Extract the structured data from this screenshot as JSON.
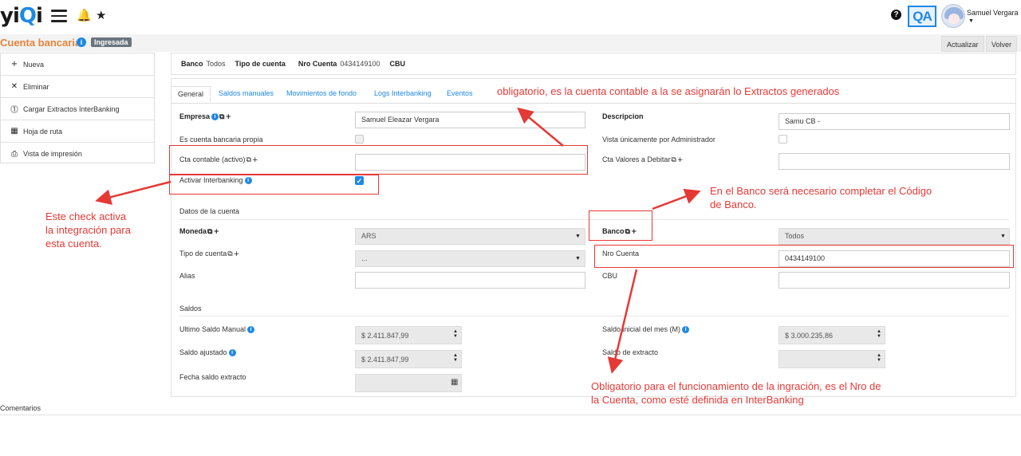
{
  "app": {
    "logo_prefix": "yi",
    "logo_q": "Q",
    "logo_suffix": "i",
    "bell_icon": "🔔",
    "star_icon": "★",
    "help_label": "?",
    "qa_label": "QA",
    "user_name": "Samuel Vergara"
  },
  "title": {
    "text": "Cuenta bancaria",
    "info": "i",
    "status": "Ingresada",
    "update_btn": "Actualizar",
    "back_btn": "Volver"
  },
  "sidebar": {
    "items": [
      {
        "icon": "+",
        "label": "Nueva"
      },
      {
        "icon": "✕",
        "label": "Eliminar"
      },
      {
        "icon": "⓵",
        "label": "Cargar Extractos InterBanking"
      },
      {
        "icon": "▦",
        "label": "Hoja de ruta"
      },
      {
        "icon": "⎙",
        "label": "Vista de impresión"
      }
    ]
  },
  "infostrip": {
    "banco_label": "Banco",
    "banco_value": "Todos",
    "tipo_label": "Tipo de cuenta",
    "nro_label": "Nro Cuenta",
    "nro_value": "0434149100",
    "cbu_label": "CBU"
  },
  "tabs": [
    "General",
    "Saldos manuales",
    "Movimientos de fondo",
    "Logs Interbanking",
    "Eventos"
  ],
  "form": {
    "empresa_label": "Empresa",
    "empresa_value": "Samuel Eleazar Vergara",
    "descripcion_label": "Descripcion",
    "descripcion_value": "Samu CB -",
    "propia_label": "Es cuenta bancaria propia",
    "admin_label": "Vista únicamente por Administrador",
    "cta_contable_label": "Cta contable (activo)",
    "cta_valores_label": "Cta Valores a Debitar",
    "interbanking_label": "Activar Interbanking",
    "datos_section": "Datos de la cuenta",
    "moneda_label": "Moneda",
    "moneda_value": "ARS",
    "banco_label": "Banco",
    "banco_value": "Todos",
    "tipo_label": "Tipo de cuenta",
    "tipo_value": "...",
    "nro_label": "Nro Cuenta",
    "nro_value": "0434149100",
    "alias_label": "Alias",
    "cbu_label": "CBU",
    "saldos_section": "Saldos",
    "ultimo_label": "Ultimo Saldo Manual",
    "ultimo_value": "$ 2.411.847,99",
    "inicial_label": "Saldo inicial del mes (M)",
    "inicial_value": "$ 3.000.235,86",
    "ajustado_label": "Saldo ajustado",
    "ajustado_value": "$ 2.411.847,99",
    "extracto_label": "Saldo de extracto",
    "fecha_label": "Fecha saldo extracto"
  },
  "annotations": {
    "top": "obligatorio, es la cuenta contable a la se asignarán lo Extractos generados",
    "left_1": "Este check activa",
    "left_2": "la integración para",
    "left_3": "esta cuenta.",
    "banco_1": "En el Banco será necesario completar el Código",
    "banco_2": "de Banco.",
    "nro_1": "Obligatorio para el funcionamiento de la ingración, es el Nro de",
    "nro_2": "la Cuenta, como esté definida en InterBanking"
  },
  "comments_label": "Comentarios",
  "colors": {
    "accent": "#1e88e5",
    "title": "#e8833a",
    "annotation": "#e53935"
  }
}
